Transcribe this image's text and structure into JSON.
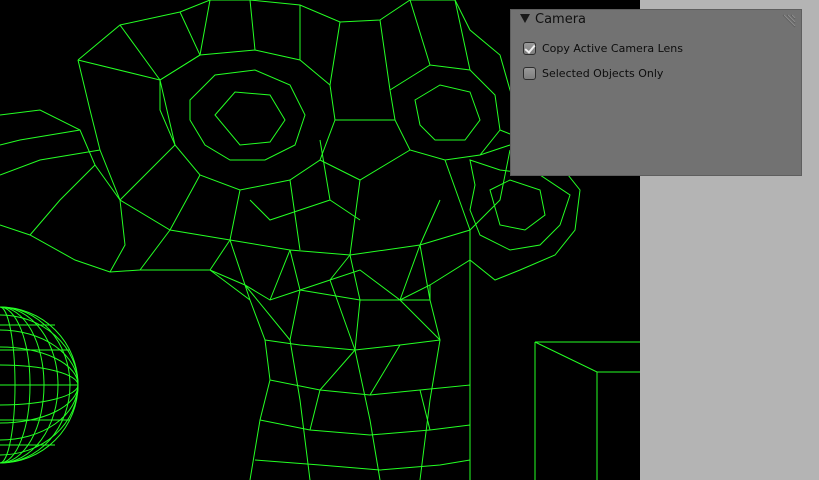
{
  "panel": {
    "title": "Camera",
    "options": [
      {
        "label": "Copy Active Camera Lens",
        "checked": true
      },
      {
        "label": "Selected Objects Only",
        "checked": false
      }
    ]
  },
  "icons": {
    "collapse": "triangle-down-icon",
    "resize": "resize-grip-icon",
    "check": "checkmark-icon"
  },
  "colors": {
    "wire": "#24ff24",
    "viewport_bg": "#000000",
    "panel_bg": "#727272",
    "side_bg": "#b4b4b4"
  }
}
